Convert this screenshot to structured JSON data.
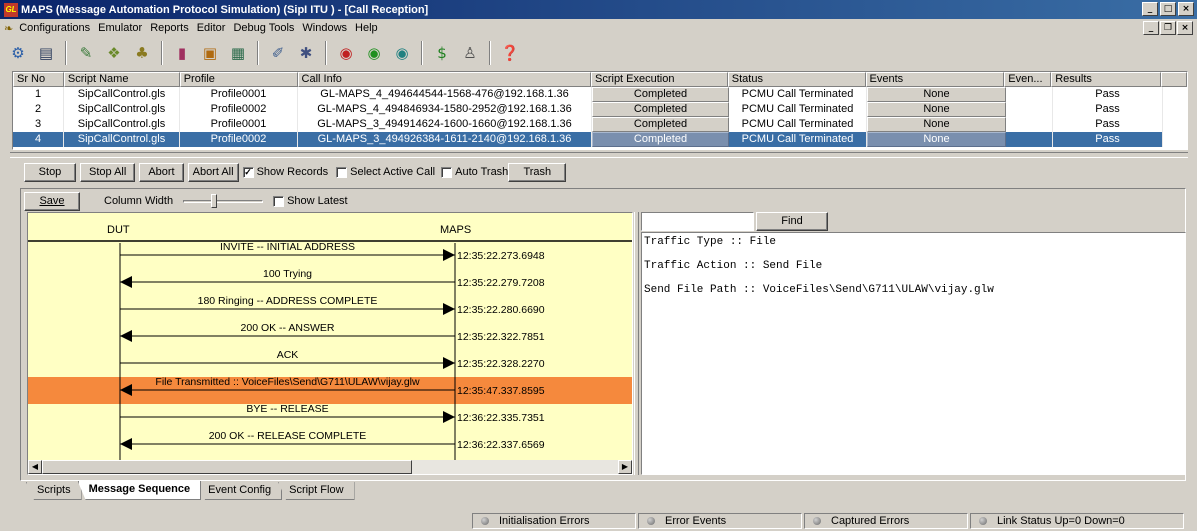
{
  "window": {
    "app_badge": "GL",
    "title": "MAPS (Message Automation Protocol Simulation)  (SipI ITU ) - [Call Reception]",
    "controls": [
      "_",
      "□",
      "×"
    ]
  },
  "menubar": {
    "items": [
      "Configurations",
      "Emulator",
      "Reports",
      "Editor",
      "Debug Tools",
      "Windows",
      "Help"
    ],
    "mdi_controls": [
      "_",
      "❐",
      "×"
    ]
  },
  "toolbar": {
    "icons": [
      "gear-icon",
      "notes-icon",
      "scripts-icon",
      "profiles-icon",
      "users-icon",
      "database-icon",
      "toolbox-icon",
      "screen-icon",
      "edit-icon",
      "wrench-icon",
      "record-red-icon",
      "record-green-icon",
      "record-teal-icon",
      "currency-icon",
      "script-icon",
      "help-icon"
    ]
  },
  "call_table": {
    "columns": [
      "Sr No",
      "Script Name",
      "Profile",
      "Call Info",
      "Script Execution",
      "Status",
      "Events",
      "Even...",
      "Results"
    ],
    "rows": [
      {
        "sr": "1",
        "script": "SipCallControl.gls",
        "profile": "Profile0001",
        "call_info": "GL-MAPS_4_494644544-1568-476@192.168.1.36",
        "execution": "Completed",
        "status": "PCMU Call Terminated",
        "events": "None",
        "even": "",
        "result": "Pass"
      },
      {
        "sr": "2",
        "script": "SipCallControl.gls",
        "profile": "Profile0002",
        "call_info": "GL-MAPS_4_494846934-1580-2952@192.168.1.36",
        "execution": "Completed",
        "status": "PCMU Call Terminated",
        "events": "None",
        "even": "",
        "result": "Pass"
      },
      {
        "sr": "3",
        "script": "SipCallControl.gls",
        "profile": "Profile0001",
        "call_info": "GL-MAPS_3_494914624-1600-1660@192.168.1.36",
        "execution": "Completed",
        "status": "PCMU Call Terminated",
        "events": "None",
        "even": "",
        "result": "Pass"
      },
      {
        "sr": "4",
        "script": "SipCallControl.gls",
        "profile": "Profile0002",
        "call_info": "GL-MAPS_3_494926384-1611-2140@192.168.1.36",
        "execution": "Completed",
        "status": "PCMU Call Terminated",
        "events": "None",
        "even": "",
        "result": "Pass"
      }
    ],
    "selected_row": 3
  },
  "controls": {
    "stop": "Stop",
    "stop_all": "Stop All",
    "abort": "Abort",
    "abort_all": "Abort All",
    "show_records": {
      "label": "Show Records",
      "checked": true
    },
    "select_active_call": {
      "label": "Select Active Call",
      "checked": false
    },
    "auto_trash": {
      "label": "Auto Trash",
      "checked": false
    },
    "trash": "Trash"
  },
  "panel": {
    "save": "Save",
    "column_width_label": "Column Width",
    "show_latest": {
      "label": "Show Latest",
      "checked": false
    },
    "find_button": "Find",
    "find_value": ""
  },
  "ladder": {
    "left_label": "DUT",
    "right_label": "MAPS",
    "highlight_color": "#f5893d",
    "background_color": "#ffffc4",
    "messages": [
      {
        "label": "INVITE -- INITIAL ADDRESS",
        "direction": "right",
        "time": "12:35:22.273.6948",
        "highlight": false
      },
      {
        "label": "100  Trying",
        "direction": "left",
        "time": "12:35:22.279.7208",
        "highlight": false
      },
      {
        "label": "180  Ringing -- ADDRESS COMPLETE",
        "direction": "right",
        "time": "12:35:22.280.6690",
        "highlight": false
      },
      {
        "label": "200  OK -- ANSWER",
        "direction": "left",
        "time": "12:35:22.322.7851",
        "highlight": false
      },
      {
        "label": "ACK",
        "direction": "right",
        "time": "12:35:22.328.2270",
        "highlight": false
      },
      {
        "label": "File Transmitted :: VoiceFiles\\Send\\G711\\ULAW\\vijay.glw",
        "direction": "left",
        "time": "12:35:47.337.8595",
        "highlight": true
      },
      {
        "label": "BYE -- RELEASE",
        "direction": "right",
        "time": "12:36:22.335.7351",
        "highlight": false
      },
      {
        "label": "200  OK -- RELEASE COMPLETE",
        "direction": "left",
        "time": "12:36:22.337.6569",
        "highlight": false
      }
    ]
  },
  "detail": {
    "lines": [
      "Traffic Type :: File",
      "Traffic Action :: Send File",
      "Send File Path :: VoiceFiles\\Send\\G711\\ULAW\\vijay.glw"
    ]
  },
  "tabs": [
    "Scripts",
    "Message Sequence",
    "Event Config",
    "Script Flow"
  ],
  "active_tab": 1,
  "statusbar": [
    "Initialisation Errors",
    "Error Events",
    "Captured Errors",
    "Link Status Up=0 Down=0"
  ]
}
